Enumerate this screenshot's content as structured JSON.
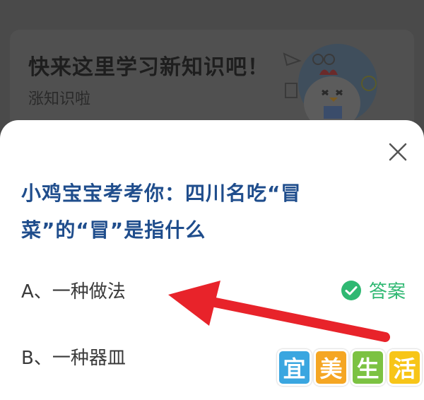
{
  "banner": {
    "title": "快来这里学习新知识吧！",
    "subtitle": "涨知识啦"
  },
  "question": {
    "text": "小鸡宝宝考考你：四川名吃“冒菜”的“冒”是指什么"
  },
  "options": [
    {
      "label": "A、一种做法",
      "is_answer": true,
      "answer_tag": "答案"
    },
    {
      "label": "B、一种器皿",
      "is_answer": false
    }
  ],
  "watermark": {
    "chars": [
      "宜",
      "美",
      "生",
      "活"
    ]
  },
  "colors": {
    "question": "#1f4d8c",
    "answer_green": "#2fb872",
    "arrow_red": "#e8232a"
  },
  "icons": {
    "close": "close-icon",
    "check": "check-circle-icon",
    "mascot": "chicken-mascot-illustration"
  }
}
